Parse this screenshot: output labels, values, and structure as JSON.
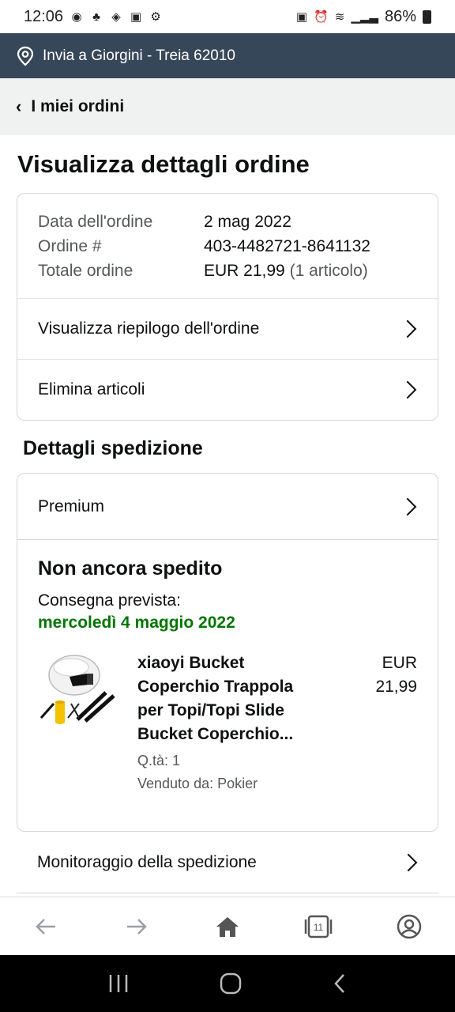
{
  "status_bar": {
    "time": "12:06",
    "battery": "86%"
  },
  "location": {
    "text": "Invia a Giorgini - Treia 62010"
  },
  "back": {
    "label": "I miei ordini"
  },
  "title": "Visualizza dettagli ordine",
  "order": {
    "date_label": "Data dell'ordine",
    "date_value": "2 mag 2022",
    "number_label": "Ordine #",
    "number_value": "403-4482721-8641132",
    "total_label": "Totale ordine",
    "total_value": "EUR 21,99",
    "total_items": "(1 articolo)",
    "links": [
      "Visualizza riepilogo dell'ordine",
      "Elimina articoli"
    ]
  },
  "shipping": {
    "section_title": "Dettagli spedizione",
    "method": "Premium",
    "status": "Non ancora spedito",
    "delivery_label": "Consegna prevista:",
    "delivery_date": "mercoledì 4 maggio 2022",
    "product": {
      "name": "xiaoyi Bucket Coperchio Trappola per Topi/Topi Slide Bucket Coperchio...",
      "qty": "Q.tà: 1",
      "seller": "Venduto da: Pokier",
      "price_currency": "EUR",
      "price_value": "21,99"
    },
    "tracking_label": "Monitoraggio della spedizione"
  },
  "colors": {
    "header_bg": "#37475a",
    "delivery_green": "#007600",
    "page_bg_strip": "#f0f2f2"
  },
  "icons": [
    "location-pin-icon",
    "back-arrow-icon",
    "forward-arrow-icon",
    "home-icon",
    "tabs-icon",
    "account-icon"
  ],
  "bottom_bar": {
    "tabs_count": "11"
  }
}
